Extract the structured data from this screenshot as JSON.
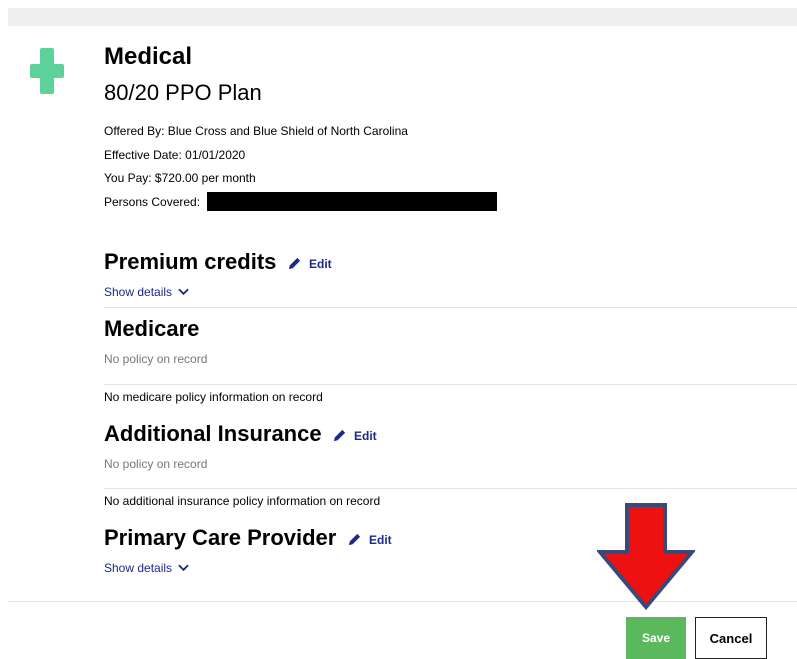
{
  "plan": {
    "icon": "plus-icon",
    "title": "Medical",
    "name": "80/20 PPO Plan",
    "offered_by": "Offered By: Blue Cross and Blue Shield of North Carolina",
    "effective_date": "Effective Date: 01/01/2020",
    "you_pay": "You Pay: $720.00 per month",
    "persons_covered_label": "Persons Covered:"
  },
  "sections": {
    "premium_credits": {
      "title": "Premium credits",
      "edit": "Edit",
      "show_details": "Show details"
    },
    "medicare": {
      "title": "Medicare",
      "status": "No policy on record",
      "note": "No medicare policy information on record"
    },
    "additional_insurance": {
      "title": "Additional Insurance",
      "edit": "Edit",
      "status": "No policy on record",
      "note": "No additional insurance policy information on record"
    },
    "primary_care_provider": {
      "title": "Primary Care Provider",
      "edit": "Edit",
      "show_details": "Show details"
    }
  },
  "actions": {
    "save": "Save",
    "cancel": "Cancel"
  },
  "colors": {
    "accent_green": "#5cd29a",
    "link_blue": "#1b2a88",
    "save_green": "#5cb85c",
    "arrow_red": "#ee1111",
    "arrow_outline": "#3a4a78"
  }
}
